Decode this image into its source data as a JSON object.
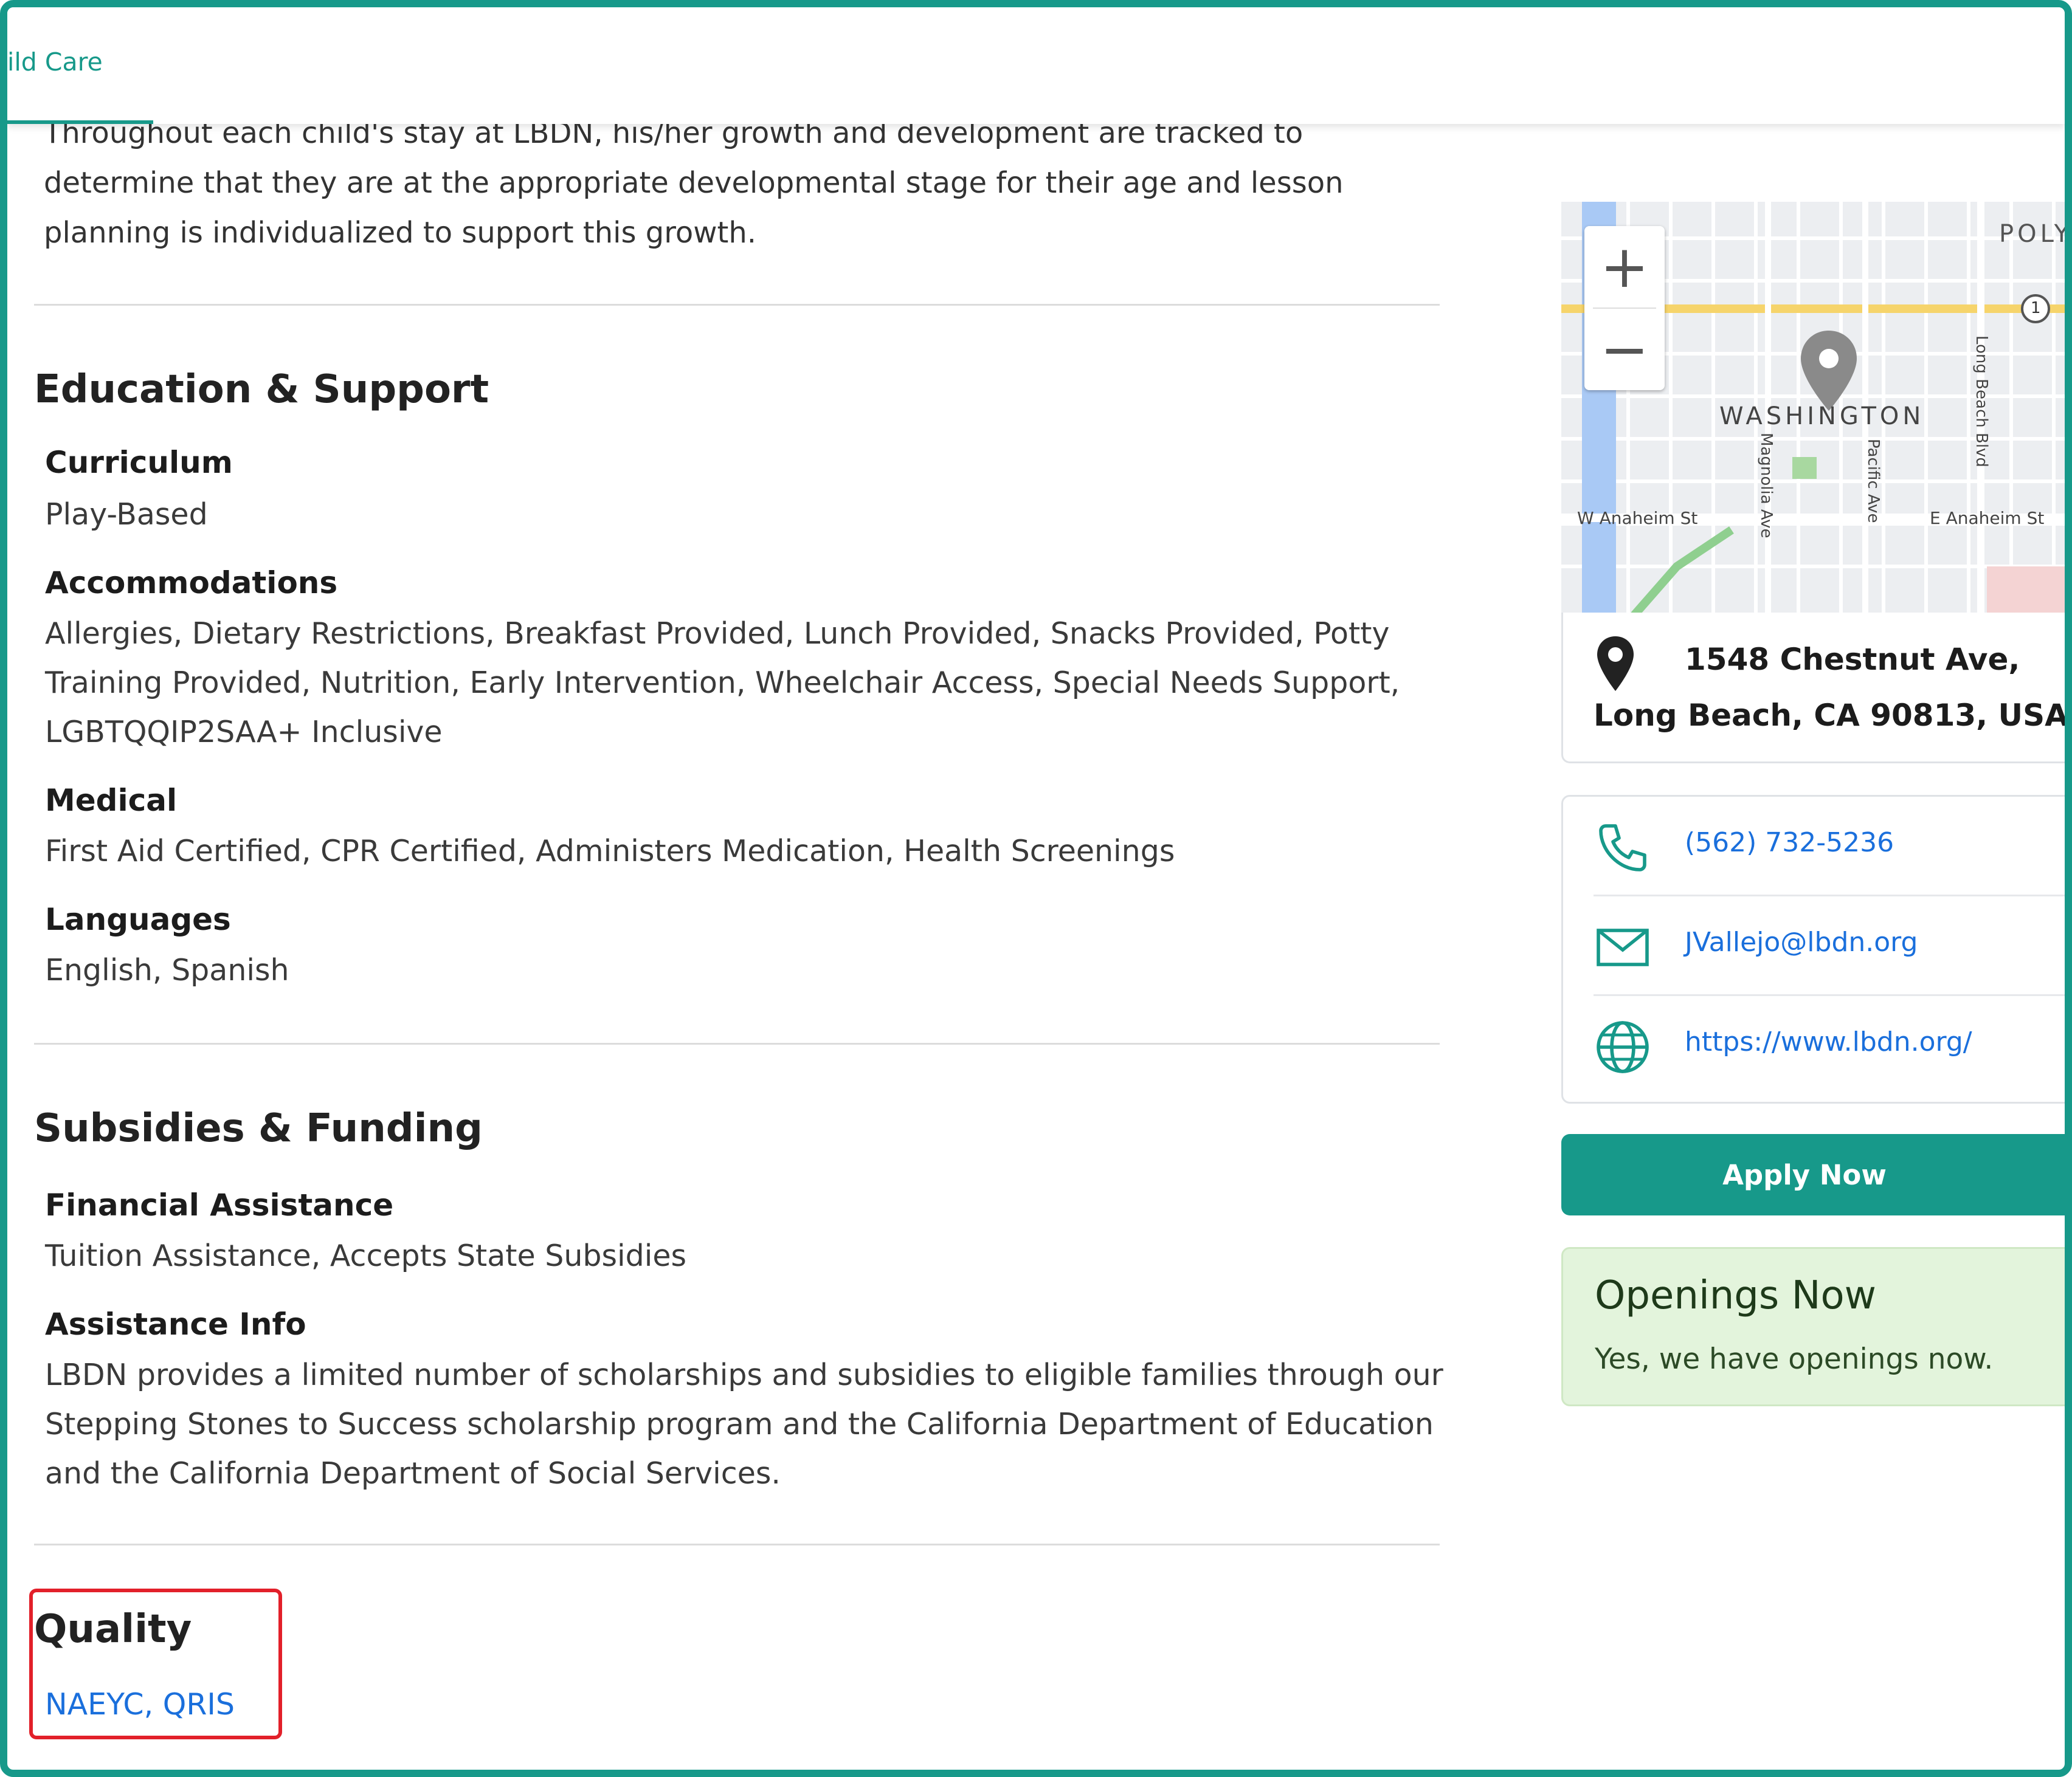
{
  "header": {
    "breadcrumb": "ild Care"
  },
  "intro_text": "Throughout each child's stay at LBDN, his/her growth and development are tracked to determine that they are at the appropriate developmental stage for their age and lesson planning is individualized to support this growth.",
  "education": {
    "title": "Education & Support",
    "curriculum_label": "Curriculum",
    "curriculum_value": "Play-Based",
    "accommodations_label": "Accommodations",
    "accommodations_value": "Allergies, Dietary Restrictions, Breakfast Provided, Lunch Provided, Snacks Provided, Potty Training Provided, Nutrition, Early Intervention, Wheelchair Access, Special Needs Support, LGBTQQIP2SAA+ Inclusive",
    "medical_label": "Medical",
    "medical_value": "First Aid Certified, CPR Certified, Administers Medication, Health Screenings",
    "languages_label": "Languages",
    "languages_value": "English, Spanish"
  },
  "subsidies": {
    "title": "Subsidies & Funding",
    "financial_label": "Financial Assistance",
    "financial_value": "Tuition Assistance, Accepts State Subsidies",
    "info_label": "Assistance Info",
    "info_value": "LBDN provides a limited number of scholarships and subsidies to eligible families through our Stepping Stones to Success scholarship program and the California Department of Education and the California Department of Social Services."
  },
  "quality": {
    "title": "Quality",
    "value": "NAEYC, QRIS"
  },
  "map": {
    "zoom_in": "+",
    "zoom_out": "−",
    "labels": {
      "neighborhood": "WASHINGTON",
      "poly": "POLY",
      "w_anaheim": "W Anaheim St",
      "e_anaheim": "E Anaheim St",
      "magnolia": "Magnolia Ave",
      "pacific": "Pacific Ave",
      "long_beach_blvd": "Long Beach Blvd",
      "route": "1"
    }
  },
  "address": {
    "line1": "1548 Chestnut Ave,",
    "line2": "Long Beach, CA 90813, USA"
  },
  "contact": {
    "phone": "(562) 732-5236",
    "email": "JVallejo@lbdn.org",
    "website": "https://www.lbdn.org/"
  },
  "apply_label": "Apply Now",
  "openings": {
    "title": "Openings Now",
    "text": "Yes, we have openings now."
  },
  "colors": {
    "accent": "#17998a",
    "link": "#1a6fdc",
    "highlight": "#e2202a",
    "openings_bg": "#e3f4dc"
  }
}
